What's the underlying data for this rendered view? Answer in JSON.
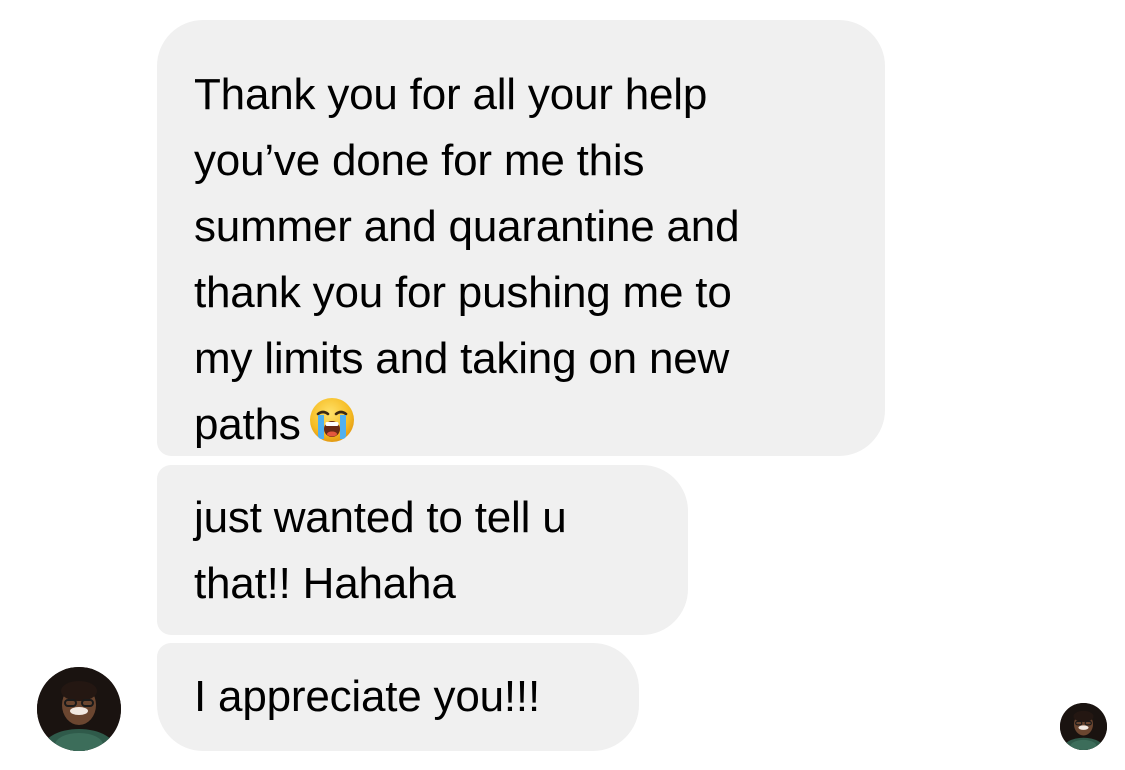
{
  "conversation": {
    "messages": [
      {
        "sender": "contact",
        "lines": [
          "Thank you for all your help",
          "you’ve done for me this",
          "summer and quarantine and",
          "thank you for pushing me to",
          "my limits and taking on new",
          "paths"
        ],
        "emoji": "loudly-crying-face-icon"
      },
      {
        "sender": "contact",
        "lines": [
          "just wanted to tell u",
          "that!! Hahaha"
        ]
      },
      {
        "sender": "contact",
        "lines": [
          "I appreciate you!!!"
        ]
      }
    ],
    "bubble_color": "#f0f0f0",
    "text_color": "#000000",
    "sender_avatar": "contact-avatar",
    "read_receipt_avatar": "seen-by-avatar"
  }
}
